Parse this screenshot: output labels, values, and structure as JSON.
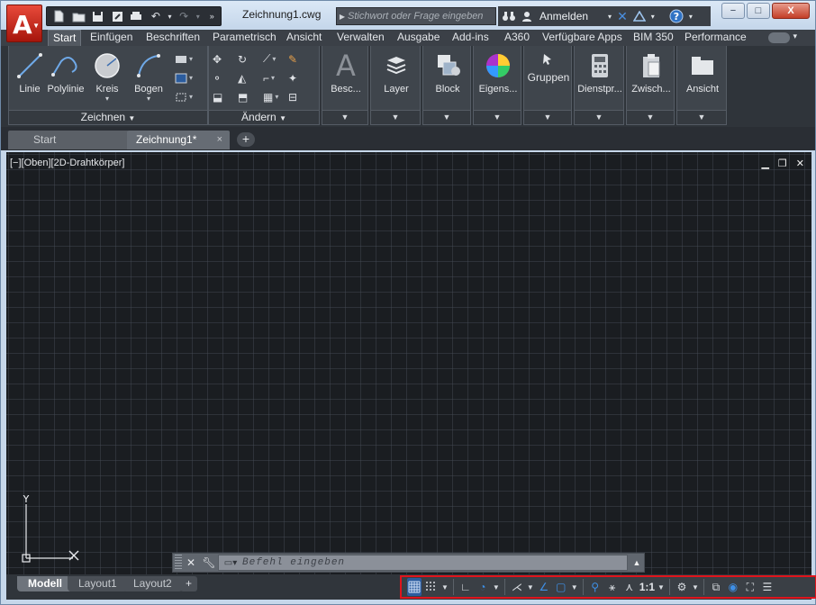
{
  "window": {
    "doc_title": "Zeichnung1.cwg",
    "min_label": "−",
    "max_label": "□",
    "close_label": "X"
  },
  "search": {
    "placeholder": "Stichwort oder Frage eingeben"
  },
  "toprow": {
    "login_label": "Anmelden"
  },
  "ribbon_tabs": [
    "Start",
    "Einfügen",
    "Beschriften",
    "Parametrisch",
    "Ansicht",
    "Verwalten",
    "Ausgabe",
    "Add-ins",
    "A360",
    "Verfügbare Apps",
    "BIM 350",
    "Performance"
  ],
  "ribbon_tabs_active": "Start",
  "panels": {
    "zeichnen": {
      "title": "Zeichnen",
      "tools": [
        "Linie",
        "Polylinie",
        "Kreis",
        "Bogen"
      ]
    },
    "aendern": {
      "title": "Ändern"
    },
    "big": [
      "Besc...",
      "Layer",
      "Block",
      "Eigens...",
      "Gruppen",
      "Dienstpr...",
      "Zwisch...",
      "Ansicht"
    ]
  },
  "file_tabs": {
    "start": "Start",
    "doc": "Zeichnung1*",
    "close": "×",
    "add": "+"
  },
  "viewport": {
    "label": "[−][Oben][2D-Drahtkörper]",
    "ucs_y": "Y"
  },
  "command": {
    "placeholder": "Befehl eingeben"
  },
  "layout_tabs": [
    "Modell",
    "Layout1",
    "Layout2"
  ],
  "layout_add": "+",
  "status": {
    "scale": "1:1"
  },
  "colors": {
    "accent_red": "#e0141c",
    "brand_red": "#c42b1c",
    "status_blue": "#3e8fe6",
    "canvas_bg": "#1a1d21"
  }
}
